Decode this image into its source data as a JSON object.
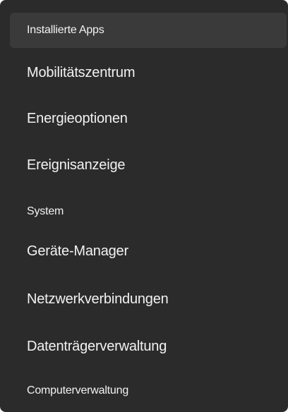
{
  "menu": {
    "items": [
      {
        "label": "Installierte Apps"
      },
      {
        "label": "Mobilitätszentrum"
      },
      {
        "label": "Energieoptionen"
      },
      {
        "label": "Ereignisanzeige"
      },
      {
        "label": "System"
      },
      {
        "label": "Geräte-Manager"
      },
      {
        "label": "Netzwerkverbindungen"
      },
      {
        "label": "Datenträgerverwaltung"
      },
      {
        "label": "Computerverwaltung"
      }
    ]
  }
}
